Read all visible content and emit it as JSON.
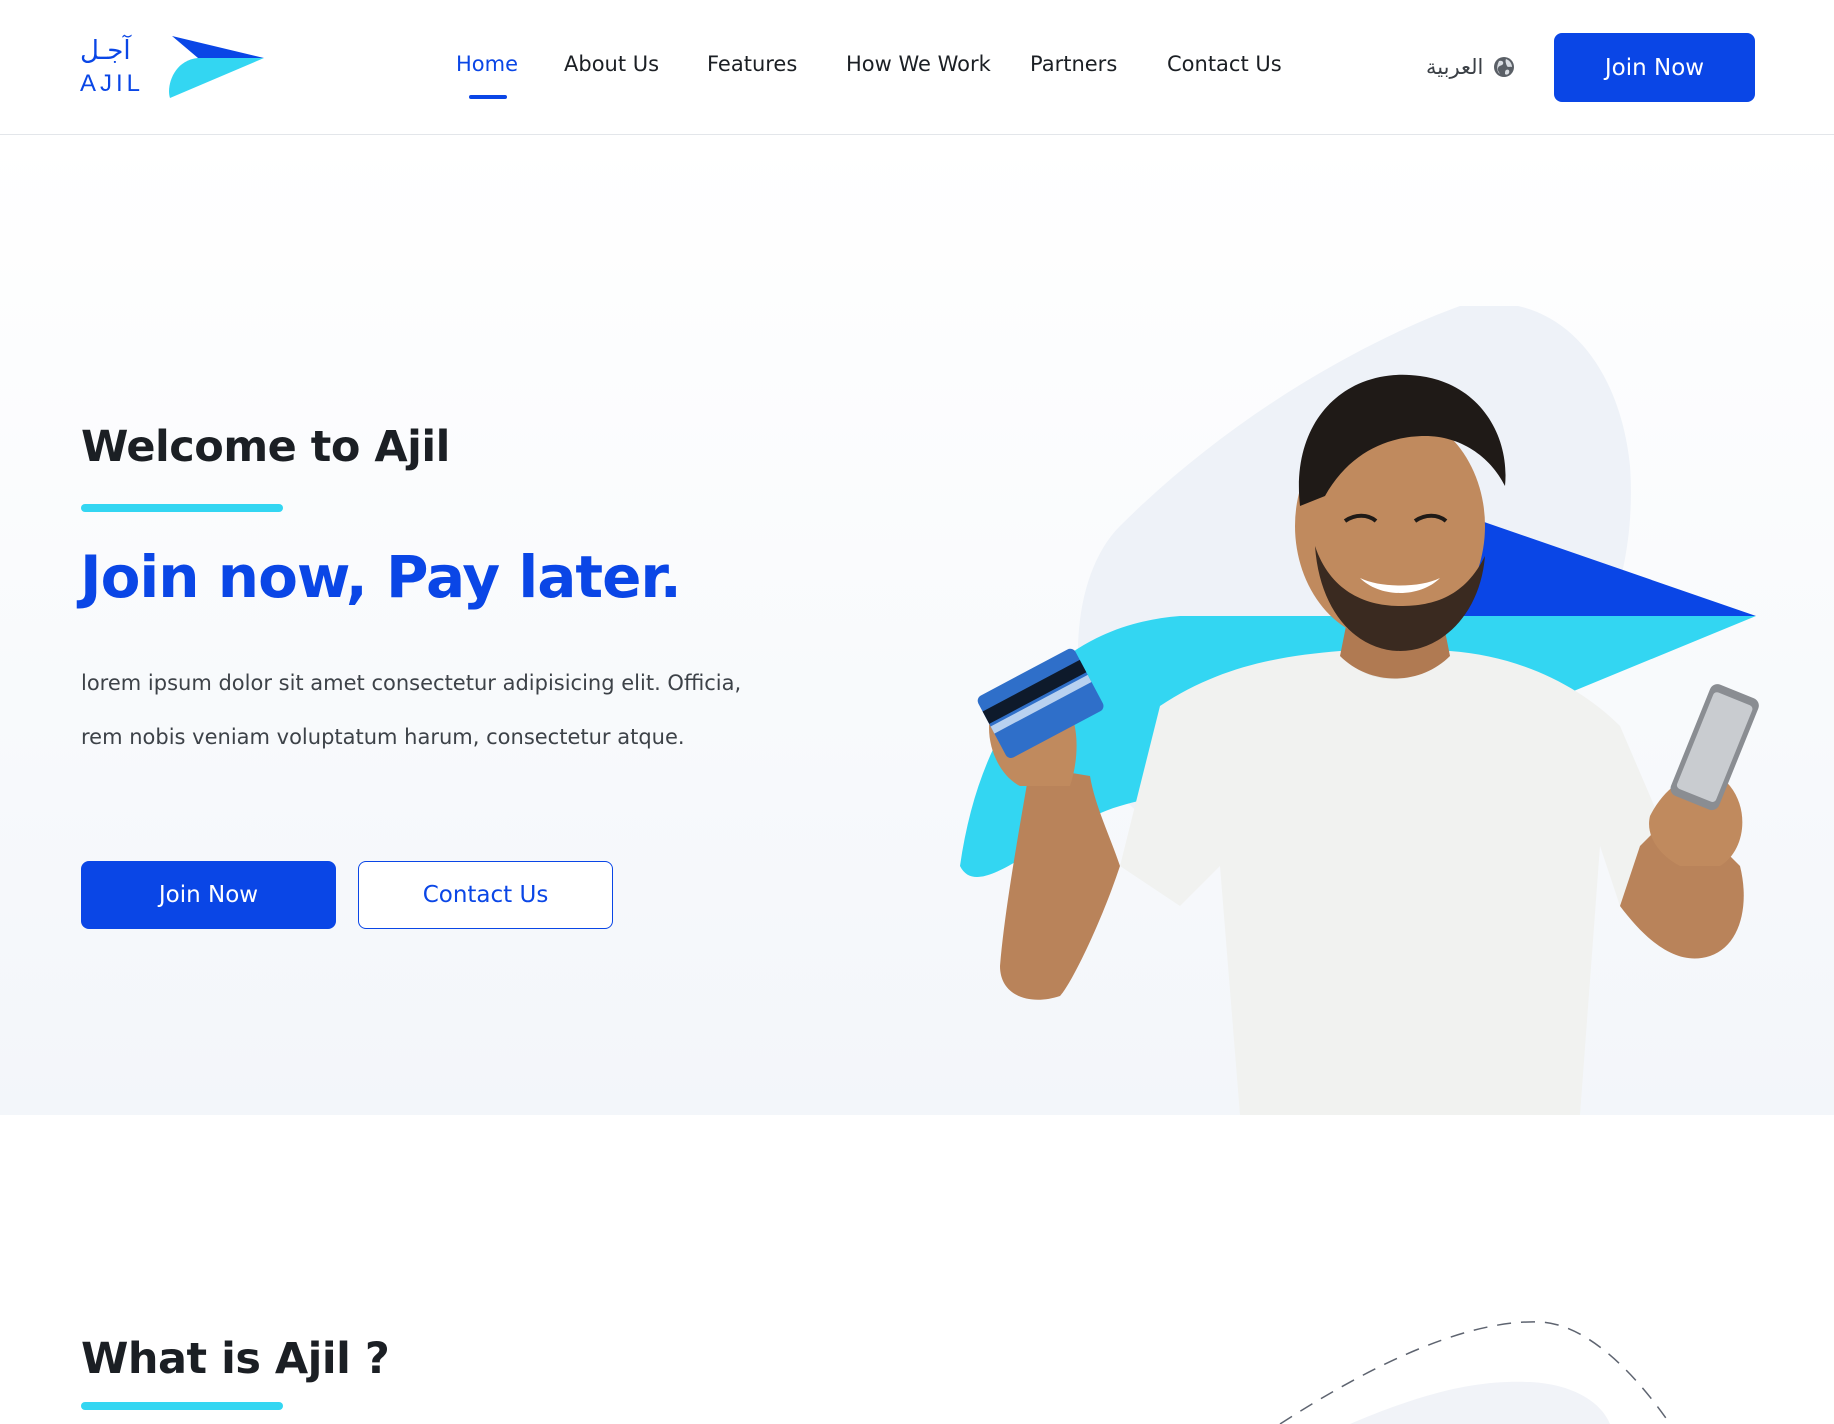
{
  "brand": {
    "name_ar": "آجـل",
    "name_en": "AJIL",
    "colors": {
      "primary": "#0a46e6",
      "accent": "#33d6f2"
    }
  },
  "nav": {
    "items": [
      {
        "label": "Home",
        "active": true
      },
      {
        "label": "About Us",
        "active": false
      },
      {
        "label": "Features",
        "active": false
      },
      {
        "label": "How We Work",
        "active": false
      },
      {
        "label": "Partners",
        "active": false
      },
      {
        "label": "Contact Us",
        "active": false
      }
    ],
    "language": {
      "label": "العربية",
      "icon": "globe-icon"
    },
    "cta_label": "Join Now"
  },
  "hero": {
    "title": "Welcome to Ajil",
    "headline": "Join now, Pay later.",
    "description": "lorem ipsum dolor sit amet consectetur adipisicing elit. Officia, rem nobis veniam voluptatum harum, consectetur atque.",
    "primary_button": "Join Now",
    "secondary_button": "Contact Us"
  },
  "what_is": {
    "title": "What is Ajil ?"
  }
}
